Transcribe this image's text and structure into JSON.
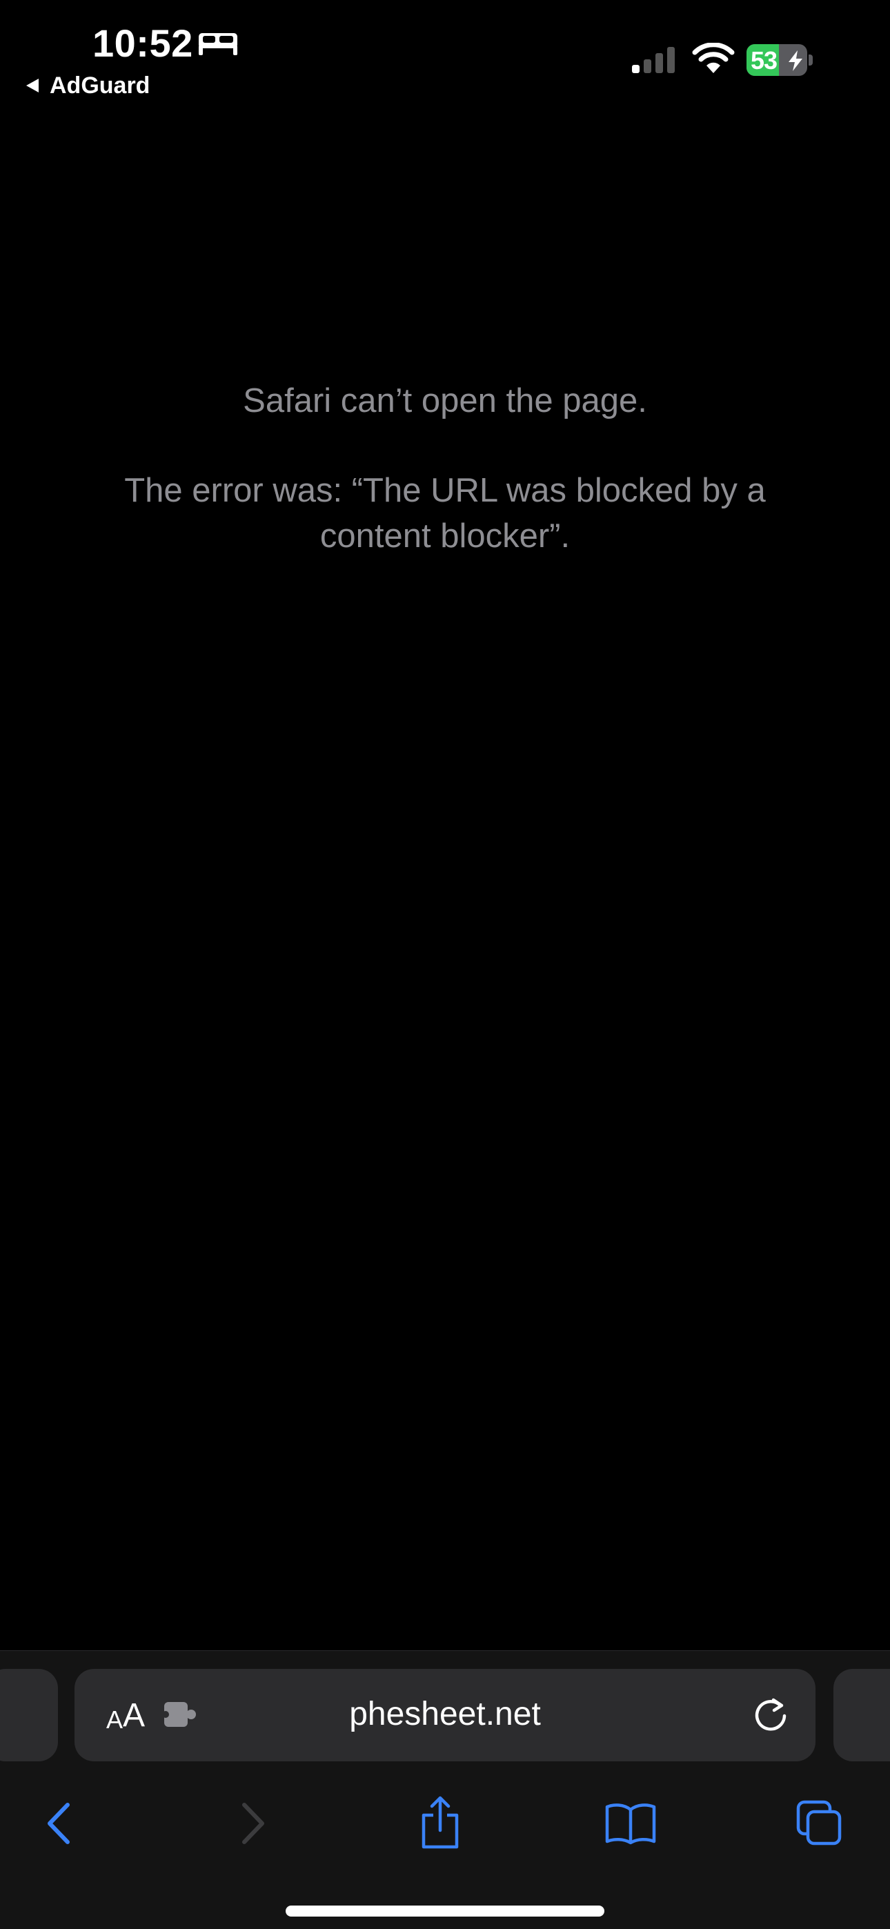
{
  "status_bar": {
    "time": "10:52",
    "back_app": "AdGuard",
    "battery_percent": "53",
    "battery_level": 0.53,
    "battery_color": "#34c759",
    "icons": [
      "bed-icon",
      "signal-icon",
      "wifi-icon",
      "battery-icon",
      "charging-bolt-icon"
    ]
  },
  "error": {
    "title": "Safari can’t open the page.",
    "detail": "The error was: “The URL was blocked by a content blocker”."
  },
  "toolbar": {
    "reader_label_small": "A",
    "reader_label_large": "A",
    "url": "phesheet.net",
    "accent_color": "#3a82f7",
    "buttons": [
      "back-icon",
      "forward-icon",
      "share-icon",
      "bookmarks-icon",
      "tabs-icon"
    ]
  }
}
